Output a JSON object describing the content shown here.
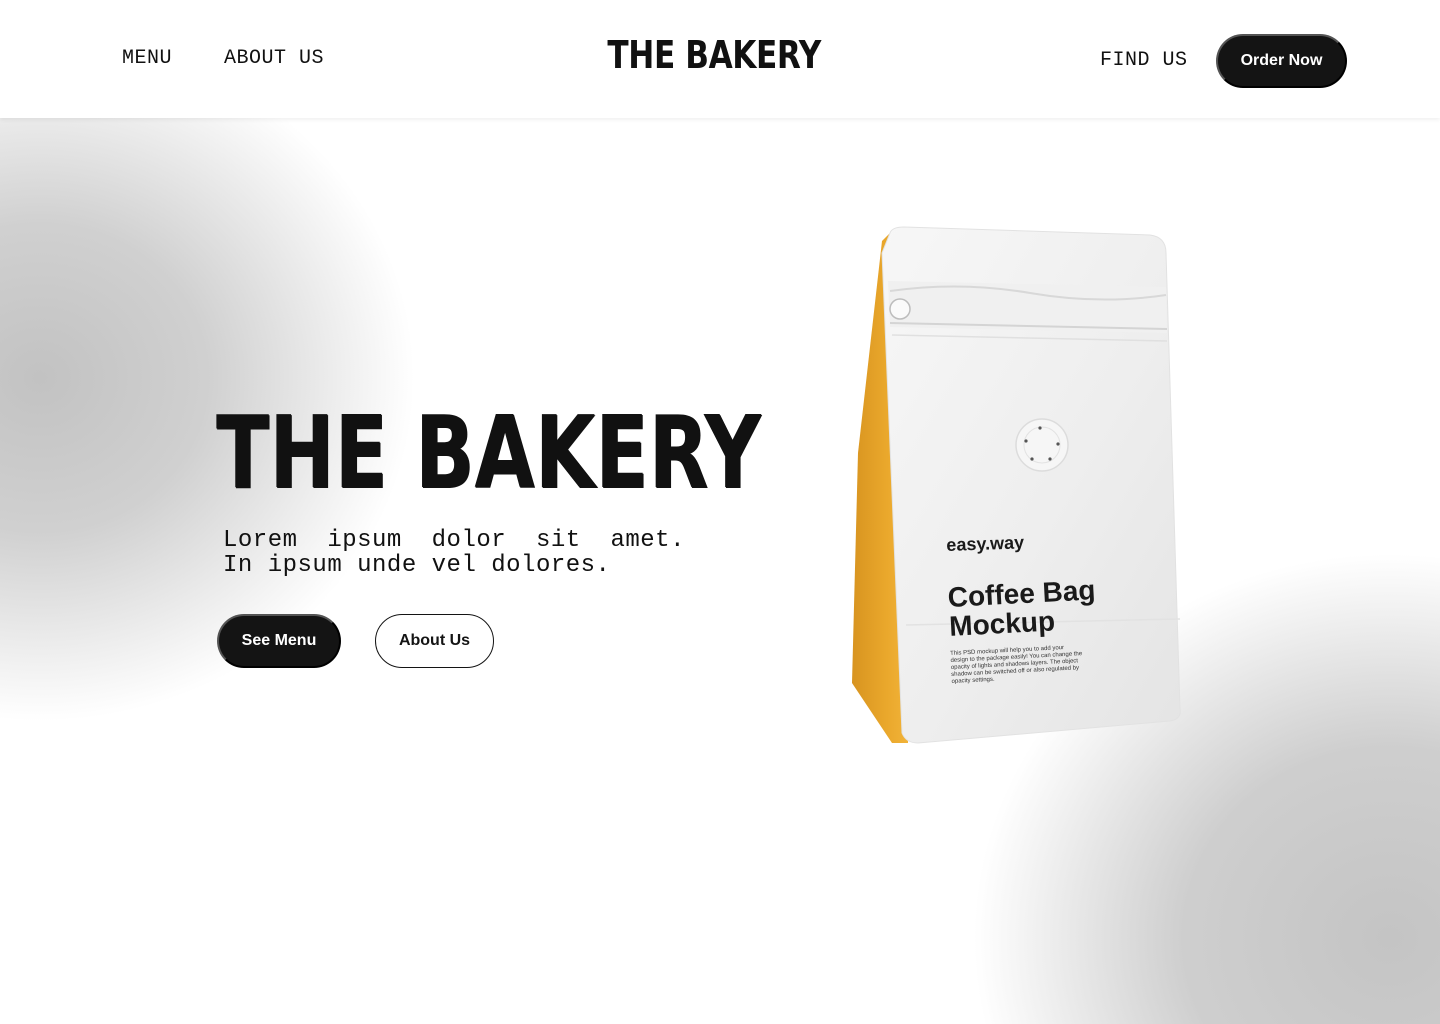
{
  "header": {
    "nav_left": [
      "MENU",
      "ABOUT US"
    ],
    "logo": "THE BAKERY",
    "nav_right": "FIND US",
    "cta": "Order Now"
  },
  "hero": {
    "title": "THE BAKERY",
    "subtitle_lines": [
      "Lorem  ipsum  dolor  sit  amet.",
      "In ipsum unde vel dolores."
    ],
    "primary_button": "See Menu",
    "secondary_button": "About Us"
  },
  "product": {
    "brand": "easy.way",
    "title": "Coffee Bag Mockup",
    "fine_print": "This PSD mockup will help you to add your design to the package easily! You can change the opacity of lights and shadows layers. The object shadow can be switched off or also regulated by opacity settings.",
    "side_color": "#E8A52A"
  },
  "colors": {
    "primary": "#141414",
    "background": "#FFFFFF",
    "gradient_gray": "#C2C2C2"
  }
}
